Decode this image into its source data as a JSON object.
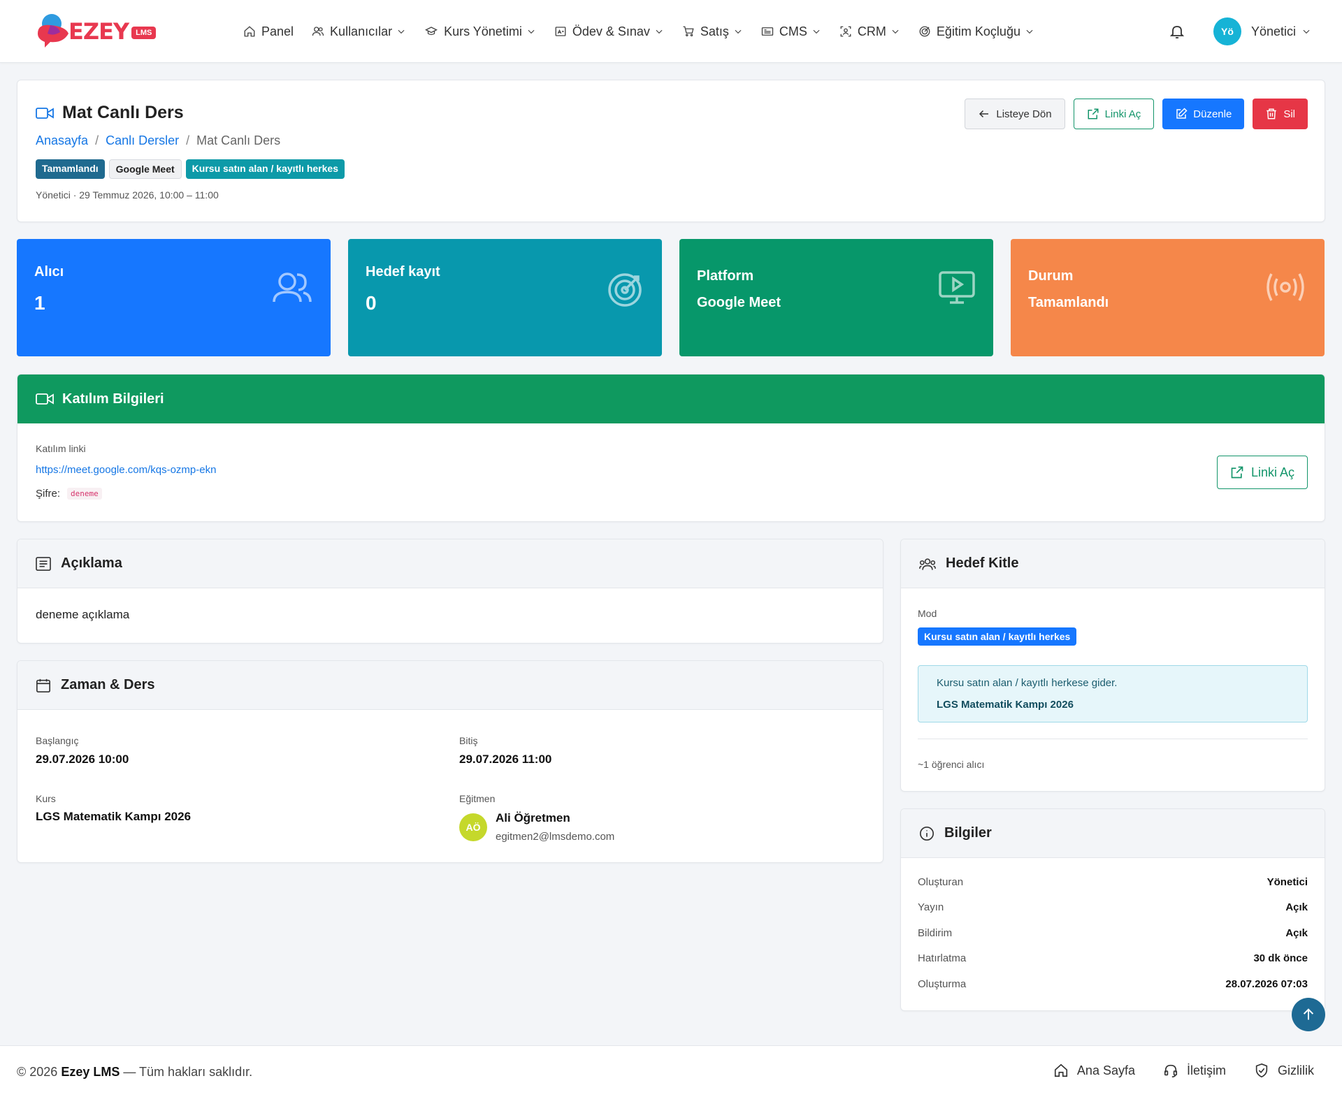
{
  "brand": {
    "name": "EZEY",
    "badge": "LMS"
  },
  "nav": [
    {
      "label": "Panel",
      "icon": "home-icon",
      "dropdown": false
    },
    {
      "label": "Kullanıcılar",
      "icon": "users-icon",
      "dropdown": true
    },
    {
      "label": "Kurs Yönetimi",
      "icon": "graduation-cap-icon",
      "dropdown": true
    },
    {
      "label": "Ödev & Sınav",
      "icon": "exam-icon",
      "dropdown": true
    },
    {
      "label": "Satış",
      "icon": "cart-icon",
      "dropdown": true
    },
    {
      "label": "CMS",
      "icon": "cms-icon",
      "dropdown": true
    },
    {
      "label": "CRM",
      "icon": "crm-icon",
      "dropdown": true
    },
    {
      "label": "Eğitim Koçluğu",
      "icon": "target-icon",
      "dropdown": true
    }
  ],
  "user": {
    "initials": "Yö",
    "name": "Yönetici"
  },
  "header": {
    "title": "Mat Canlı Ders",
    "breadcrumb": [
      "Anasayfa",
      "Canlı Dersler",
      "Mat Canlı Ders"
    ],
    "badges": [
      "Tamamlandı",
      "Google Meet",
      "Kursu satın alan / kayıtlı herkes"
    ],
    "meta": "Yönetici · 29 Temmuz 2026, 10:00 – 11:00",
    "actions": {
      "back": "Listeye Dön",
      "open": "Linki Aç",
      "edit": "Düzenle",
      "delete": "Sil"
    }
  },
  "stats": [
    {
      "label": "Alıcı",
      "value": "1",
      "color": "#1677ff"
    },
    {
      "label": "Hedef kayıt",
      "value": "0",
      "color": "#0898ad"
    },
    {
      "label": "Platform",
      "value": "Google Meet",
      "color": "#07976a"
    },
    {
      "label": "Durum",
      "value": "Tamamlandı",
      "color": "#f5874a"
    }
  ],
  "katilim": {
    "title": "Katılım Bilgileri",
    "link_label": "Katılım linki",
    "link": "https://meet.google.com/kqs-ozmp-ekn",
    "password_label": "Şifre:",
    "password": "deneme",
    "button": "Linki Aç"
  },
  "aciklama": {
    "title": "Açıklama",
    "text": "deneme açıklama"
  },
  "zaman": {
    "title": "Zaman & Ders",
    "start_label": "Başlangıç",
    "start": "29.07.2026 10:00",
    "end_label": "Bitiş",
    "end": "29.07.2026 11:00",
    "course_label": "Kurs",
    "course": "LGS Matematik Kampı 2026",
    "instructor_label": "Eğitmen",
    "instructor_initials": "AÖ",
    "instructor_name": "Ali Öğretmen",
    "instructor_email": "egitmen2@lmsdemo.com"
  },
  "hedef": {
    "title": "Hedef Kitle",
    "mode_label": "Mod",
    "mode": "Kursu satın alan / kayıtlı herkes",
    "info_text": "Kursu satın alan / kayıtlı herkese gider.",
    "info_course": "LGS Matematik Kampı 2026",
    "recipients": "~1 öğrenci alıcı"
  },
  "bilgiler": {
    "title": "Bilgiler",
    "rows": [
      {
        "k": "Oluşturan",
        "v": "Yönetici"
      },
      {
        "k": "Yayın",
        "v": "Açık"
      },
      {
        "k": "Bildirim",
        "v": "Açık"
      },
      {
        "k": "Hatırlatma",
        "v": "30 dk önce"
      },
      {
        "k": "Oluşturma",
        "v": "28.07.2026 07:03"
      }
    ]
  },
  "footer": {
    "year": "© 2026",
    "brand": "Ezey LMS",
    "rights": "— Tüm hakları saklıdır.",
    "links": [
      "Ana Sayfa",
      "İletişim",
      "Gizlilik"
    ]
  }
}
